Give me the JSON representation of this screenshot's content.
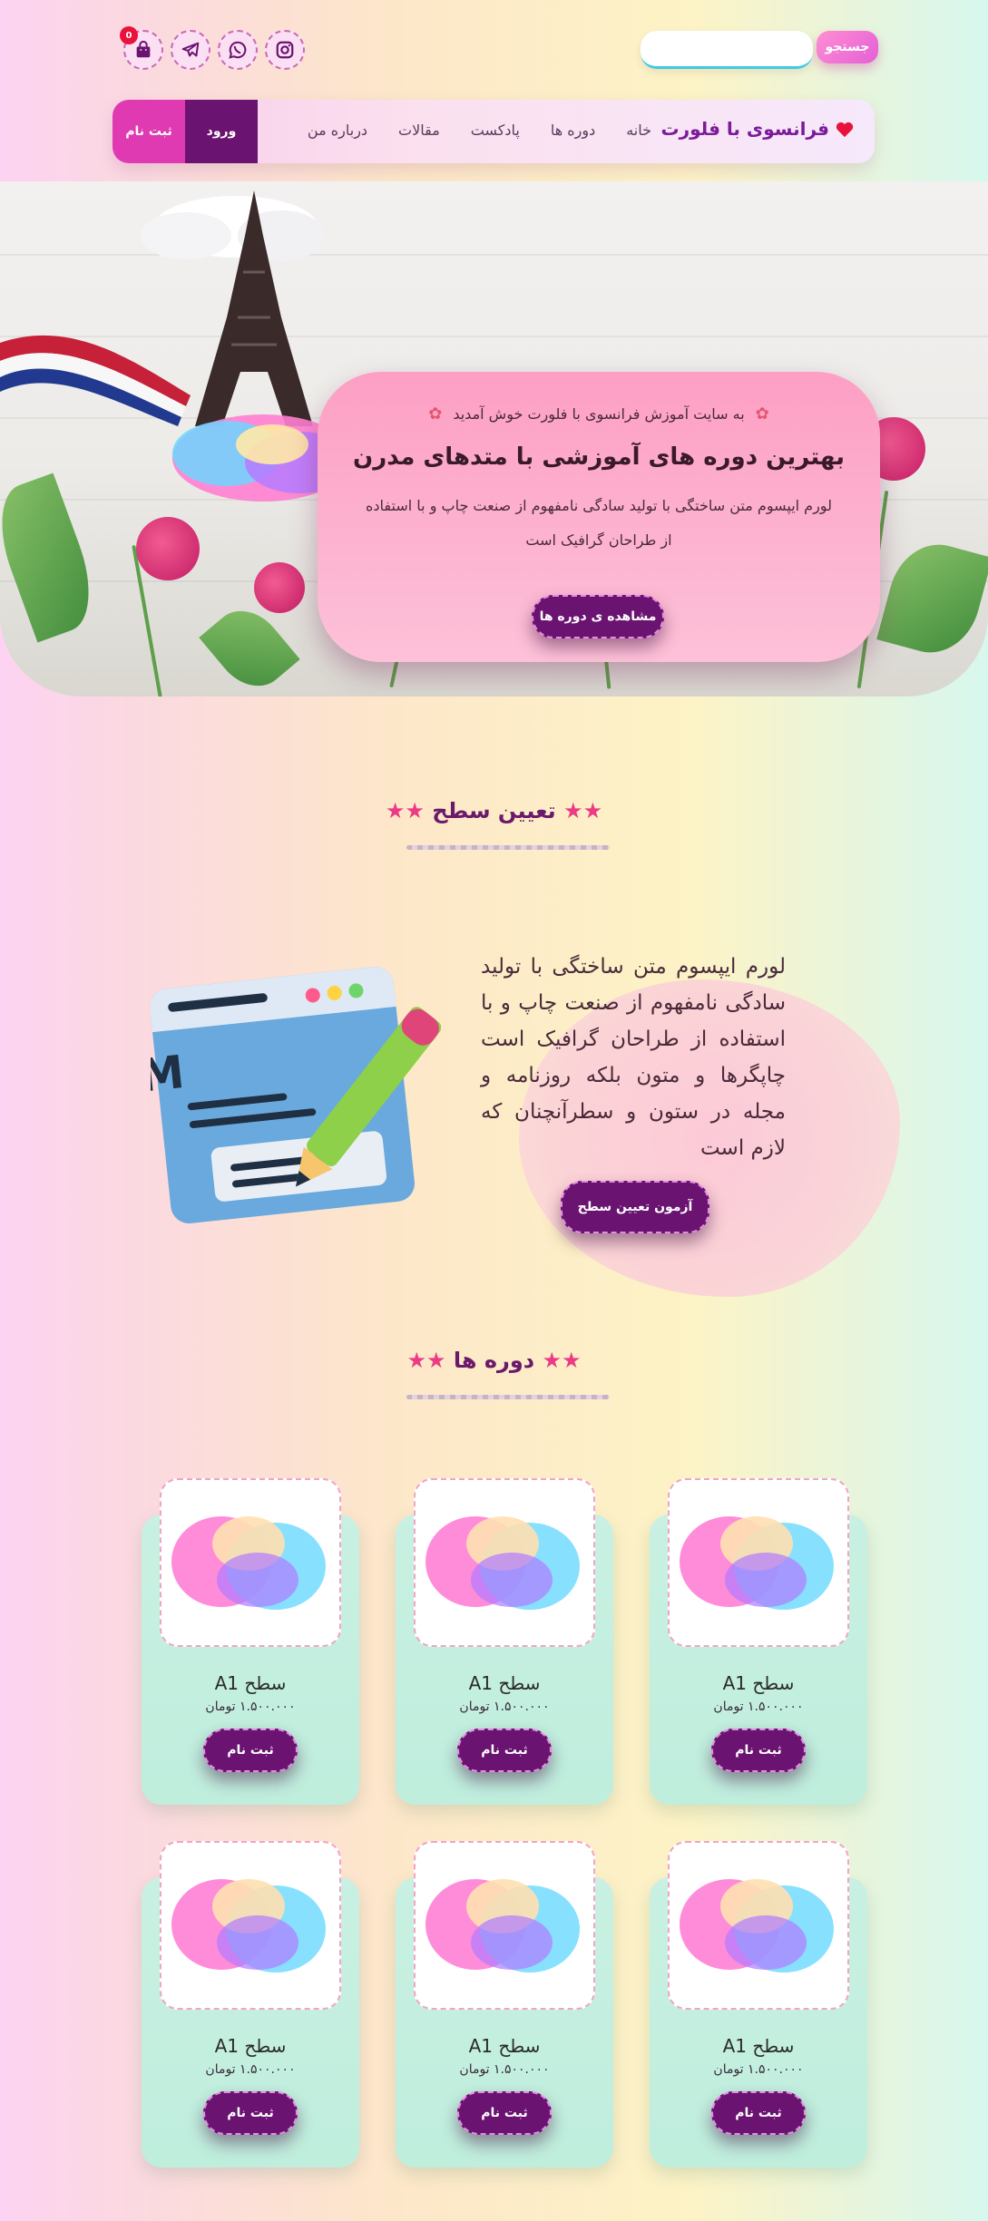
{
  "header": {
    "search_button": "جستجو",
    "search_placeholder": "",
    "cart_count": "0"
  },
  "nav": {
    "brand": "فرانسوی با فلورت",
    "links": [
      "خانه",
      "دوره ها",
      "پادکست",
      "مقالات",
      "درباره من"
    ],
    "signup": "ثبت نام",
    "login": "ورود"
  },
  "hero": {
    "welcome": "به سایت آموزش فرانسوی با فلورت خوش آمدید",
    "title": "بهترین دوره های آموزشی با متدهای مدرن",
    "description": "لورم ایپسوم متن ساختگی با تولید سادگی نامفهوم از صنعت چاپ و با استفاده از طراحان گرافیک است",
    "button": "مشاهده ی دوره ها"
  },
  "level": {
    "title": "تعیین سطح",
    "text": "لورم ایپسوم متن ساختگی با تولید سادگی نامفهوم از صنعت چاپ و با استفاده از طراحان گرافیک است چاپگرها و متون بلکه روزنامه و مجله در ستون و سطرآنچنان که لازم است",
    "button": "آزمون تعیین سطح",
    "image_label": "EXAM"
  },
  "courses": {
    "title": "دوره ها",
    "items": [
      {
        "title": "سطح A1",
        "price": "۱.۵۰۰.۰۰۰ تومان",
        "button": "ثبت نام"
      },
      {
        "title": "سطح A1",
        "price": "۱.۵۰۰.۰۰۰ تومان",
        "button": "ثبت نام"
      },
      {
        "title": "سطح A1",
        "price": "۱.۵۰۰.۰۰۰ تومان",
        "button": "ثبت نام"
      },
      {
        "title": "سطح A1",
        "price": "۱.۵۰۰.۰۰۰ تومان",
        "button": "ثبت نام"
      },
      {
        "title": "سطح A1",
        "price": "۱.۵۰۰.۰۰۰ تومان",
        "button": "ثبت نام"
      },
      {
        "title": "سطح A1",
        "price": "۱.۵۰۰.۰۰۰ تومان",
        "button": "ثبت نام"
      }
    ]
  },
  "icons": {
    "social": [
      "instagram-icon",
      "whatsapp-icon",
      "telegram-icon",
      "shopping-bag-icon"
    ],
    "brand": "heart-icon"
  },
  "colors": {
    "primary": "#6a1371",
    "accent": "#e03ab2",
    "star": "#ec3b84",
    "hero_card": "#fdb2cf",
    "card_bg": "#c9f0e2"
  }
}
